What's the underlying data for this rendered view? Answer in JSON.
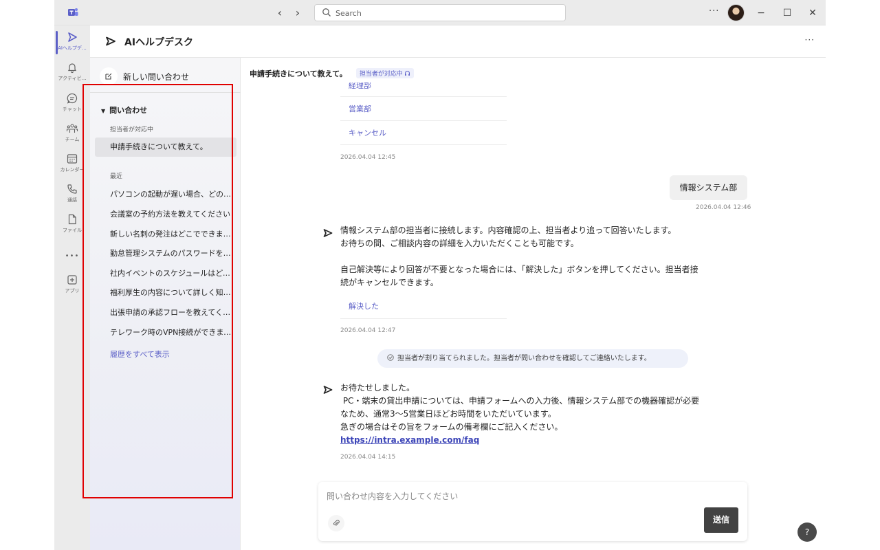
{
  "titlebar": {
    "search_placeholder": "Search",
    "back_glyph": "‹",
    "forward_glyph": "›",
    "more_glyph": "···",
    "minimize_glyph": "−",
    "maximize_glyph": "☐",
    "close_glyph": "✕"
  },
  "rail": {
    "items": [
      {
        "label": "AIヘルプデ…",
        "icon": "send-icon",
        "active": true
      },
      {
        "label": "アクティビ…",
        "icon": "bell-icon"
      },
      {
        "label": "チャット",
        "icon": "chat-icon"
      },
      {
        "label": "チーム",
        "icon": "teams-icon"
      },
      {
        "label": "カレンダー",
        "icon": "calendar-icon"
      },
      {
        "label": "通話",
        "icon": "phone-icon"
      },
      {
        "label": "ファイル",
        "icon": "file-icon"
      },
      {
        "label": "•••",
        "icon": "more-icon"
      },
      {
        "label": "アプリ",
        "icon": "apps-icon"
      }
    ]
  },
  "header": {
    "title": "AIヘルプデスク",
    "more_glyph": "···"
  },
  "sidebar": {
    "new_inquiry": "新しい問い合わせ",
    "section_title": "問い合わせ",
    "in_progress_label": "担当者が対応中",
    "in_progress_items": [
      "申請手続きについて教えて。"
    ],
    "recent_label": "最近",
    "recent_items": [
      "パソコンの起動が遅い場合、どのように対処すればよいですか？",
      "会議室の予約方法を教えてください",
      "新しい名刺の発注はどこでできますか？",
      "勤怠管理システムのパスワードを忘れました",
      "社内イベントのスケジュールはどこで確認できますか？",
      "福利厚生の内容について詳しく知りたいです",
      "出張申請の承認フローを教えてください",
      "テレワーク時のVPN接続ができません"
    ],
    "show_all": "履歴をすべて表示"
  },
  "conversation": {
    "title": "申請手続きについて教えて。",
    "status_badge": "担当者が対応中",
    "options": [
      "経理部",
      "営業部",
      "キャンセル"
    ],
    "ts_options": "2026.04.04 12:45",
    "user_message": "情報システム部",
    "ts_user": "2026.04.04 12:46",
    "bot1_line1": "情報システム部の担当者に接続します。内容確認の上、担当者より追って回答いたします。",
    "bot1_line2": "お待ちの間、ご相談内容の詳細を入力いただくことも可能です。",
    "bot1_line3": "自己解決等により回答が不要となった場合には、「解決した」ボタンを押してください。担当者接",
    "bot1_line4": "続がキャンセルできます。",
    "resolve_button": "解決した",
    "ts_bot1": "2026.04.04 12:47",
    "system_notice": "担当者が割り当てられました。担当者が問い合わせを確認してご連絡いたします。",
    "bot2_line1": "お待たせしました。",
    "bot2_line2": " PC・端末の貸出申請については、申請フォームへの入力後、情報システム部での機器確認が必要",
    "bot2_line3": "なため、通常3〜5営業日ほどお時間をいただいています。",
    "bot2_line4": "急ぎの場合はその旨をフォームの備考欄にご記入ください。",
    "bot2_link": "https://intra.example.com/faq",
    "ts_bot2": "2026.04.04 14:15"
  },
  "composer": {
    "placeholder": "問い合わせ内容を入力してください",
    "send_label": "送信"
  },
  "help": {
    "label": "?"
  },
  "colors": {
    "accent": "#5b5fc7",
    "annotation_frame": "#e00000",
    "send_button": "#424242"
  }
}
